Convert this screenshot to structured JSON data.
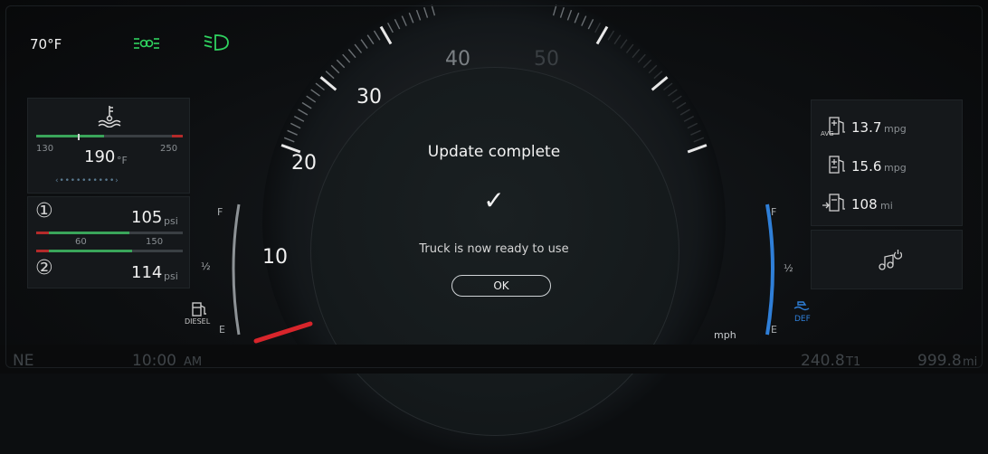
{
  "status": {
    "temperature": "70°F",
    "lamp_lights_icon": "parking-lights-icon",
    "lamp_headlight_icon": "low-beam-icon",
    "lamp_color": "#2fd25f"
  },
  "coolant": {
    "min": "130",
    "max": "250",
    "value": "190",
    "unit": "°F",
    "fill_fraction": 0.5,
    "dots": "‹ • • • • • • • • • • ›"
  },
  "oil": {
    "gauge1_label": "①",
    "gauge1_value": "105",
    "gauge1_unit": "psi",
    "gauge1_fraction": 0.6,
    "scale_low": "60",
    "scale_high": "150",
    "gauge2_label": "②",
    "gauge2_value": "114",
    "gauge2_unit": "psi",
    "gauge2_fraction": 0.62
  },
  "fuel_left": {
    "full": "F",
    "half": "½",
    "empty": "E",
    "label": "DIESEL",
    "icon": "fuel-pump-icon"
  },
  "speedometer": {
    "labels": [
      "10",
      "20",
      "30",
      "40",
      "50"
    ],
    "unit": "mph"
  },
  "modal": {
    "title": "Update complete",
    "check": "✓",
    "message": "Truck is now ready to use",
    "ok_label": "OK"
  },
  "def_gauge": {
    "full": "F",
    "half": "½",
    "empty": "E",
    "label": "DEF",
    "color": "#2f7fd8"
  },
  "trip": {
    "avg_value": "13.7",
    "avg_unit": "mpg",
    "inst_value": "15.6",
    "inst_unit": "mpg",
    "range_value": "108",
    "range_unit": "mi",
    "media_icon": "music-power-icon"
  },
  "bottom": {
    "heading": "NE",
    "time": "10:00",
    "time_suffix": "AM",
    "trip": "240.8",
    "trip_unit": "T1",
    "odometer": "999.8",
    "odometer_unit": "mi"
  }
}
